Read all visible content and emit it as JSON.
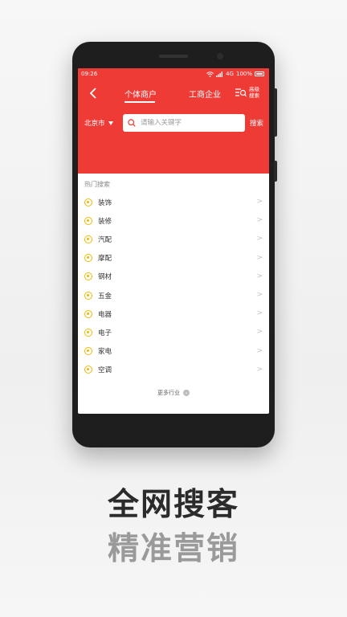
{
  "status": {
    "time": "09:26",
    "network": "4G",
    "battery": "100%"
  },
  "nav": {
    "back_icon": "chevron-left-icon",
    "tabs": [
      "个体商户",
      "工商企业"
    ],
    "advanced_search": "高级搜索"
  },
  "search": {
    "city": "北京市",
    "placeholder": "请输入关键字",
    "button": "搜索"
  },
  "hot": {
    "title": "热门搜索",
    "items": [
      "装饰",
      "装修",
      "汽配",
      "摩配",
      "钢材",
      "五金",
      "电器",
      "电子",
      "家电",
      "空调"
    ],
    "more": "更多行业"
  },
  "slogan": {
    "line1": "全网搜客",
    "line2": "精准营销"
  },
  "colors": {
    "brand_red": "#ee3b36",
    "icon_yellow": "#f1b900"
  }
}
